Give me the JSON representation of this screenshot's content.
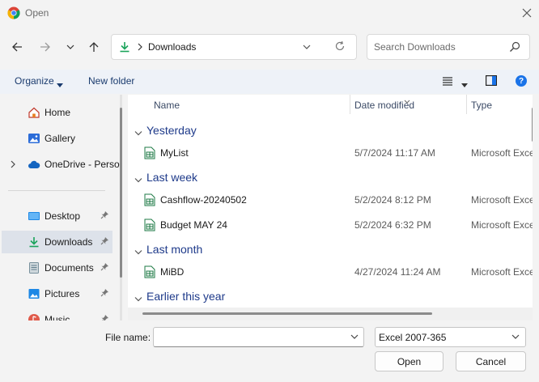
{
  "window": {
    "title": "Open"
  },
  "address": {
    "location": "Downloads"
  },
  "search": {
    "placeholder": "Search Downloads"
  },
  "command_bar": {
    "organize_label": "Organize",
    "new_folder_label": "New folder",
    "help_label": "?"
  },
  "sidebar": {
    "items": [
      {
        "label": "Home",
        "icon": "home-icon"
      },
      {
        "label": "Gallery",
        "icon": "gallery-icon"
      },
      {
        "label": "OneDrive - Perso",
        "icon": "cloud-icon"
      },
      {
        "label": "Desktop",
        "icon": "desktop-icon",
        "pinned": true
      },
      {
        "label": "Downloads",
        "icon": "download-icon",
        "pinned": true,
        "selected": true
      },
      {
        "label": "Documents",
        "icon": "documents-icon",
        "pinned": true
      },
      {
        "label": "Pictures",
        "icon": "pictures-icon",
        "pinned": true
      },
      {
        "label": "Music",
        "icon": "music-icon",
        "pinned": true
      }
    ]
  },
  "file_list": {
    "columns": {
      "name": "Name",
      "date": "Date modified",
      "type": "Type"
    },
    "groups": [
      {
        "label": "Yesterday",
        "rows": [
          {
            "name": "MyList",
            "date": "5/7/2024 11:17 AM",
            "type": "Microsoft Exce"
          }
        ]
      },
      {
        "label": "Last week",
        "rows": [
          {
            "name": "Cashflow-20240502",
            "date": "5/2/2024 8:12 PM",
            "type": "Microsoft Exce"
          },
          {
            "name": "Budget MAY 24",
            "date": "5/2/2024 6:32 PM",
            "type": "Microsoft Exce"
          }
        ]
      },
      {
        "label": "Last month",
        "rows": [
          {
            "name": "MiBD",
            "date": "4/27/2024 11:24 AM",
            "type": "Microsoft Exce"
          }
        ]
      },
      {
        "label": "Earlier this year",
        "rows": []
      }
    ]
  },
  "bottom": {
    "filename_label": "File name:",
    "filename_value": "",
    "filetype_selected": "Excel 2007-365",
    "open_label": "Open",
    "cancel_label": "Cancel"
  },
  "colors": {
    "accent": "#1a73e8",
    "group_heading": "#1e3a8a",
    "download_green": "#1aa35a",
    "excel_green": "#1d7a44"
  }
}
